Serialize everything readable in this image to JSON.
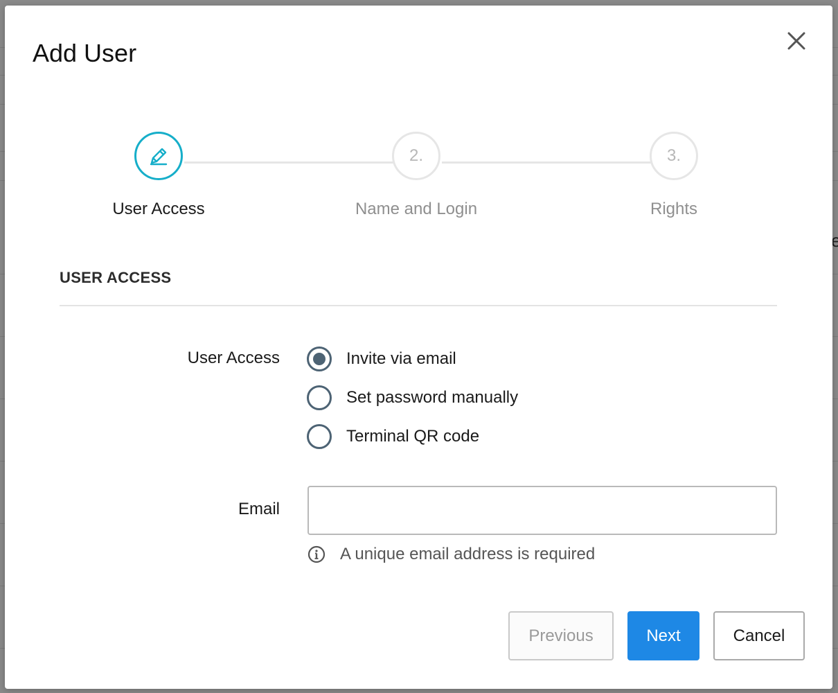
{
  "dialog": {
    "title": "Add User"
  },
  "stepper": {
    "steps": [
      {
        "label": "User Access",
        "marker": "",
        "state": "active",
        "icon": "pencil-icon"
      },
      {
        "label": "Name and Login",
        "marker": "2.",
        "state": "inactive"
      },
      {
        "label": "Rights",
        "marker": "3.",
        "state": "inactive"
      }
    ]
  },
  "section": {
    "heading": "USER ACCESS"
  },
  "user_access": {
    "label": "User Access",
    "options": [
      {
        "label": "Invite via email",
        "selected": true
      },
      {
        "label": "Set password manually",
        "selected": false
      },
      {
        "label": "Terminal QR code",
        "selected": false
      }
    ]
  },
  "email": {
    "label": "Email",
    "value": "",
    "placeholder": "",
    "hint": "A unique email address is required",
    "hint_icon": "info-icon"
  },
  "buttons": {
    "previous": "Previous",
    "next": "Next",
    "cancel": "Cancel"
  },
  "colors": {
    "accent": "#16aec9",
    "primary_button": "#1e88e5",
    "radio": "#4d6374",
    "inactive_step": "#e6e6e6",
    "overlay": "#8a8a8a"
  },
  "background": {
    "partial_glyph": "e"
  }
}
